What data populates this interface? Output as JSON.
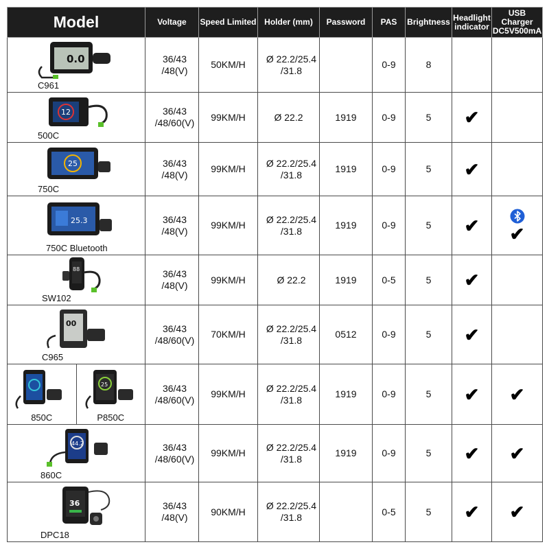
{
  "headers": {
    "model": "Model",
    "voltage": "Voltage",
    "speed": "Speed Limited",
    "holder": "Holder (mm)",
    "password": "Password",
    "pas": "PAS",
    "brightness": "Brightness",
    "headlight_1": "Headlight",
    "headlight_2": "indicator",
    "usb_1": "USB Charger",
    "usb_2": "DC5V500mA"
  },
  "check_glyph": "✔",
  "rows": [
    {
      "model": "C961",
      "volt1": "36/43",
      "volt2": "/48(V)",
      "speed": "50KM/H",
      "holder1": "Ø 22.2/25.4",
      "holder2": "/31.8",
      "password": "",
      "pas": "0-9",
      "brightness": "8",
      "headlight": "",
      "usb": ""
    },
    {
      "model": "500C",
      "volt1": "36/43",
      "volt2": "/48/60(V)",
      "speed": "99KM/H",
      "holder1": "Ø 22.2",
      "holder2": "",
      "password": "1919",
      "pas": "0-9",
      "brightness": "5",
      "headlight": "✔",
      "usb": ""
    },
    {
      "model": "750C",
      "volt1": "36/43",
      "volt2": "/48(V)",
      "speed": "99KM/H",
      "holder1": "Ø 22.2/25.4",
      "holder2": "/31.8",
      "password": "1919",
      "pas": "0-9",
      "brightness": "5",
      "headlight": "✔",
      "usb": ""
    },
    {
      "model": "750C Bluetooth",
      "volt1": "36/43",
      "volt2": "/48(V)",
      "speed": "99KM/H",
      "holder1": "Ø 22.2/25.4",
      "holder2": "/31.8",
      "password": "1919",
      "pas": "0-9",
      "brightness": "5",
      "headlight": "✔",
      "usb": "✔"
    },
    {
      "model": "SW102",
      "volt1": "36/43",
      "volt2": "/48(V)",
      "speed": "99KM/H",
      "holder1": "Ø 22.2",
      "holder2": "",
      "password": "1919",
      "pas": "0-5",
      "brightness": "5",
      "headlight": "✔",
      "usb": ""
    },
    {
      "model": "C965",
      "volt1": "36/43",
      "volt2": "/48/60(V)",
      "speed": "70KM/H",
      "holder1": "Ø 22.2/25.4",
      "holder2": "/31.8",
      "password": "0512",
      "pas": "0-9",
      "brightness": "5",
      "headlight": "✔",
      "usb": ""
    },
    {
      "model": "850C",
      "model_b": "P850C",
      "volt1": "36/43",
      "volt2": "/48/60(V)",
      "speed": "99KM/H",
      "holder1": "Ø 22.2/25.4",
      "holder2": "/31.8",
      "password": "1919",
      "pas": "0-9",
      "brightness": "5",
      "headlight": "✔",
      "usb": "✔"
    },
    {
      "model": "860C",
      "volt1": "36/43",
      "volt2": "/48/60(V)",
      "speed": "99KM/H",
      "holder1": "Ø 22.2/25.4",
      "holder2": "/31.8",
      "password": "1919",
      "pas": "0-9",
      "brightness": "5",
      "headlight": "✔",
      "usb": "✔"
    },
    {
      "model": "DPC18",
      "volt1": "36/43",
      "volt2": "/48(V)",
      "speed": "90KM/H",
      "holder1": "Ø 22.2/25.4",
      "holder2": "/31.8",
      "password": "",
      "pas": "0-5",
      "brightness": "5",
      "headlight": "✔",
      "usb": "✔"
    }
  ]
}
